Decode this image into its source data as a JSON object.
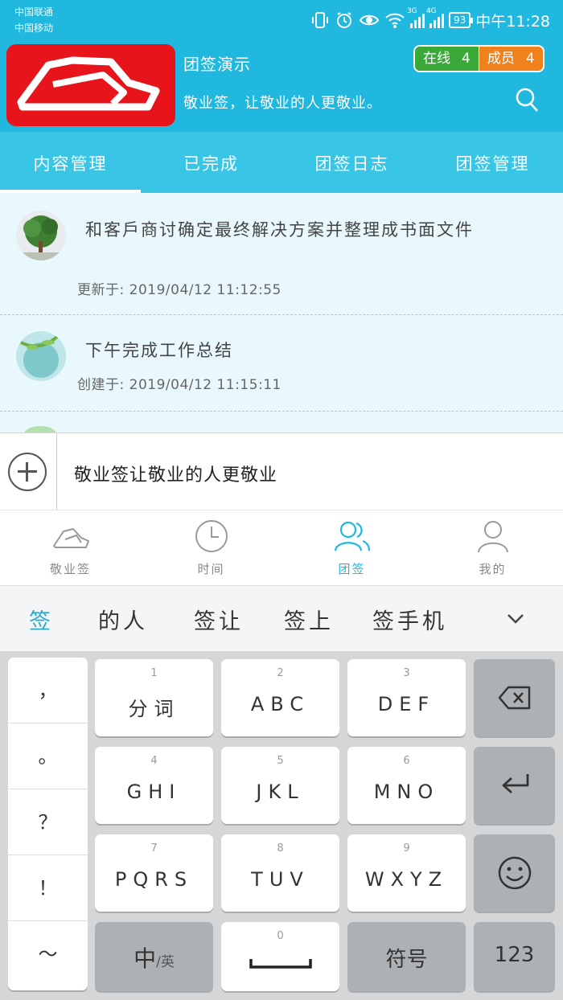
{
  "status_bar": {
    "carriers": [
      "中国联通",
      "中国移动"
    ],
    "network_3g": "3G",
    "network_4g": "4G",
    "battery": "93",
    "time": "中午11:28"
  },
  "header": {
    "team_title": "团签演示",
    "slogan": "敬业签，让敬业的人更敬业。",
    "online_label": "在线",
    "online_count": "4",
    "members_label": "成员",
    "members_count": "4"
  },
  "tabs": [
    {
      "label": "内容管理",
      "active": true
    },
    {
      "label": "已完成"
    },
    {
      "label": "团签日志"
    },
    {
      "label": "团签管理"
    }
  ],
  "items": [
    {
      "title": "和客戶商讨确定最终解决方案并整理成书面文件",
      "meta": "更新于: 2019/04/12  11:12:55"
    },
    {
      "title": "下午完成工作总结",
      "meta": "创建于: 2019/04/12  11:15:11"
    }
  ],
  "compose": {
    "text": "敬业签让敬业的人更敬业"
  },
  "nav": [
    {
      "label": "敬业签",
      "icon": "logo-icon"
    },
    {
      "label": "时间",
      "icon": "clock-icon"
    },
    {
      "label": "团签",
      "icon": "group-icon",
      "active": true
    },
    {
      "label": "我的",
      "icon": "person-icon"
    }
  ],
  "candidates": [
    "签",
    "的人",
    "签让",
    "签上",
    "签手机"
  ],
  "keyboard": {
    "punct": [
      "，",
      "。",
      "？",
      "！",
      "～"
    ],
    "keys": [
      {
        "num": "1",
        "label": "分词"
      },
      {
        "num": "2",
        "label": "ABC"
      },
      {
        "num": "3",
        "label": "DEF"
      },
      {
        "num": "4",
        "label": "GHI"
      },
      {
        "num": "5",
        "label": "JKL"
      },
      {
        "num": "6",
        "label": "MNO"
      },
      {
        "num": "7",
        "label": "PQRS"
      },
      {
        "num": "8",
        "label": "TUV"
      },
      {
        "num": "9",
        "label": "WXYZ"
      }
    ],
    "lang_main": "中",
    "lang_sub": "/英",
    "space_num": "0",
    "symbol": "符号",
    "numeric": "123"
  }
}
